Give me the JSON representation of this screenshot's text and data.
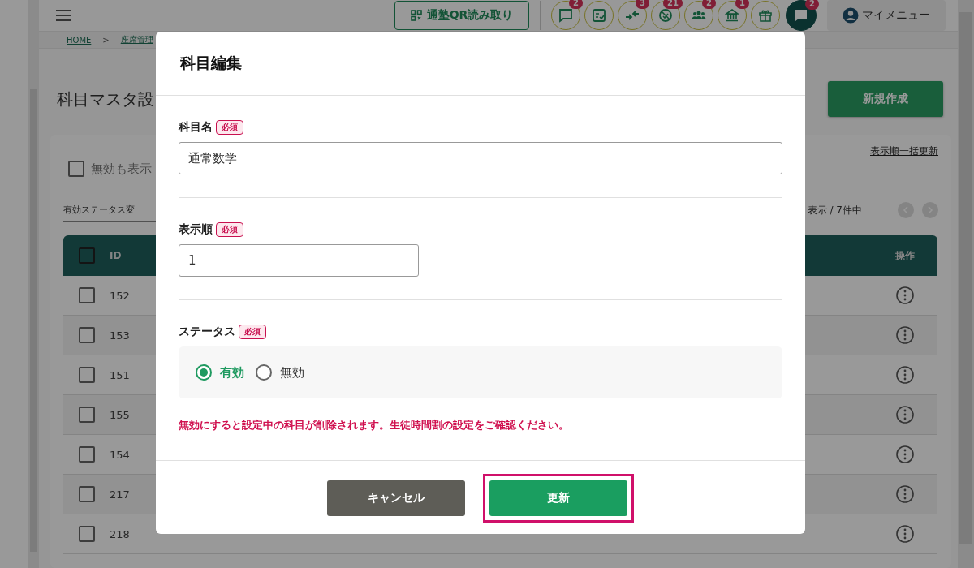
{
  "header": {
    "qr_button": "通塾QR読み取り",
    "icon_buttons": [
      {
        "kind": "chat",
        "badge": "2"
      },
      {
        "kind": "checklist"
      },
      {
        "kind": "arrows",
        "badge": "3"
      },
      {
        "kind": "blocked",
        "badge": "21"
      },
      {
        "kind": "group",
        "badge": "2"
      },
      {
        "kind": "building",
        "badge": "1"
      },
      {
        "kind": "gift"
      },
      {
        "kind": "chat-filled",
        "badge": "2"
      }
    ],
    "my_menu": "マイメニュー"
  },
  "breadcrumb": {
    "items": [
      "HOME",
      "座席管理"
    ],
    "separator": ">"
  },
  "page": {
    "title": "科目マスタ設",
    "new_button": "新規作成",
    "show_disabled": {
      "label": "無効も表示",
      "checked": false
    },
    "status_select": "有効ステータス変",
    "bulk_link": "表示順一括更新",
    "pagination": "表示 / 7件中",
    "table": {
      "header_checked": false,
      "columns": [
        "ID",
        "操作"
      ],
      "rows": [
        {
          "id": "152",
          "checked": false
        },
        {
          "id": "153",
          "checked": false
        },
        {
          "id": "151",
          "checked": false
        },
        {
          "id": "155",
          "checked": false
        },
        {
          "id": "154",
          "checked": false
        },
        {
          "id": "217",
          "checked": false
        },
        {
          "id": "218",
          "checked": false
        }
      ]
    }
  },
  "modal": {
    "title": "科目編集",
    "fields": [
      {
        "kind": "text",
        "label": "科目名",
        "required_badge": "必須",
        "value": "通常数学"
      },
      {
        "kind": "number",
        "label": "表示順",
        "required_badge": "必須",
        "value": "1"
      },
      {
        "kind": "radio",
        "label": "ステータス",
        "required_badge": "必須",
        "options": [
          {
            "label": "有効",
            "selected": true
          },
          {
            "label": "無効",
            "selected": false
          }
        ]
      }
    ],
    "warning": "無効にすると設定中の科目が削除されます。生徒時間割の設定をご確認ください。",
    "buttons": [
      {
        "label": "キャンセル",
        "kind": "secondary",
        "highlighted": false
      },
      {
        "label": "更新",
        "kind": "primary",
        "highlighted": true
      }
    ]
  }
}
